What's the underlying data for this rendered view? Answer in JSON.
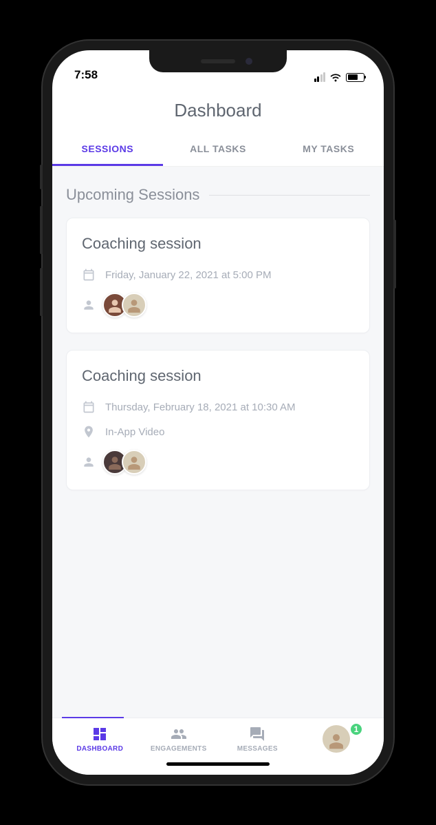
{
  "status": {
    "time": "7:58"
  },
  "header": {
    "title": "Dashboard"
  },
  "tabs": [
    {
      "label": "SESSIONS",
      "active": true
    },
    {
      "label": "ALL TASKS",
      "active": false
    },
    {
      "label": "MY TASKS",
      "active": false
    }
  ],
  "section": {
    "title": "Upcoming Sessions"
  },
  "sessions": [
    {
      "title": "Coaching session",
      "datetime": "Friday, January 22, 2021 at 5:00 PM",
      "location": null,
      "participants": 2
    },
    {
      "title": "Coaching session",
      "datetime": "Thursday, February 18, 2021 at 10:30 AM",
      "location": "In-App Video",
      "participants": 2
    }
  ],
  "bottomNav": {
    "items": [
      {
        "label": "DASHBOARD",
        "icon": "dashboard",
        "active": true
      },
      {
        "label": "ENGAGEMENTS",
        "icon": "people",
        "active": false
      },
      {
        "label": "MESSAGES",
        "icon": "chat",
        "active": false
      }
    ],
    "badge": "1"
  },
  "colors": {
    "accent": "#5b3ae6",
    "badge": "#4ad37e",
    "textMuted": "#a6acb7"
  }
}
